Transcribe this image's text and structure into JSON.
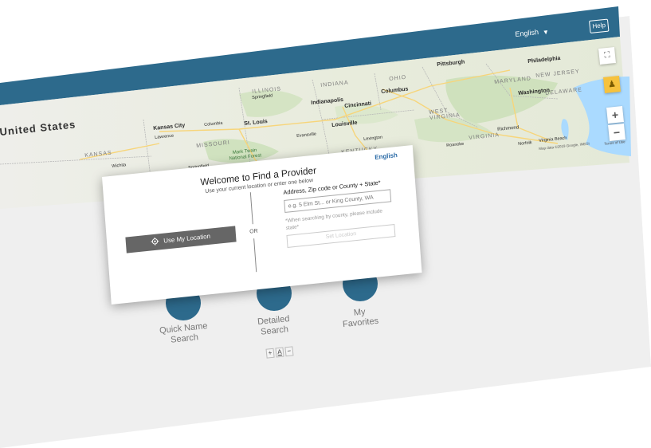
{
  "header": {
    "language": "English",
    "help_label": "Help",
    "bar_color": "#2d6a8c"
  },
  "map": {
    "country_label": "United States",
    "cities": [
      "Pittsburgh",
      "Philadelphia",
      "Washington",
      "Richmond",
      "Columbus",
      "Cincinnati",
      "Indianapolis",
      "Springfield",
      "Kansas City",
      "Lawrence",
      "Columbia",
      "St. Louis",
      "Louisville",
      "Evansville",
      "Lexington",
      "Wichita",
      "Springfield",
      "Roanoke",
      "Norfolk",
      "Virginia Beach"
    ],
    "states": [
      "ILLINOIS",
      "INDIANA",
      "OHIO",
      "MARYLAND",
      "NEW JERSEY",
      "DELAWARE",
      "WEST VIRGINIA",
      "VIRGINIA",
      "MISSOURI",
      "KANSAS",
      "KENTUCKY"
    ],
    "park": "Mark Twain National Forest",
    "attribution": "Map data ©2019 Google, INEGI",
    "terms": "Terms of Use",
    "zoom_in": "+",
    "zoom_out": "−"
  },
  "tiles": {
    "quick_name": "Quick Name Search",
    "detailed": "Detailed Search",
    "favorites": "My Favorites"
  },
  "font_controls": [
    "+",
    "A",
    "−"
  ],
  "modal": {
    "language_link": "English",
    "title": "Welcome to Find a Provider",
    "subtitle": "Use your current location or enter one below",
    "use_location_label": "Use My Location",
    "or_label": "OR",
    "address_label": "Address, Zip code or County + State*",
    "address_placeholder": "e.g. 5 Elm St... or King County, WA",
    "hint": "*When searching by county, please include state*",
    "set_location_label": "Set Location"
  }
}
